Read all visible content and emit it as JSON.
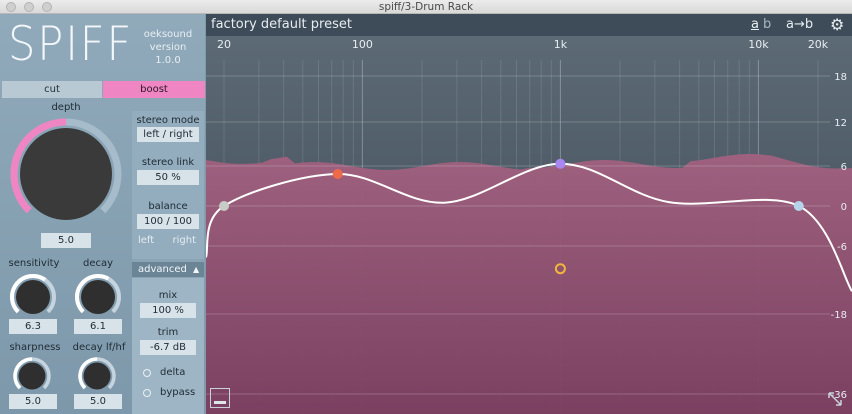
{
  "window": {
    "title": "spiff/3-Drum Rack"
  },
  "plugin": {
    "name": "SPIFF",
    "vendor": "oeksound",
    "version_label": "version",
    "version": "1.0.0"
  },
  "mode_tabs": {
    "cut": "cut",
    "boost": "boost",
    "active": "boost"
  },
  "depth": {
    "label": "depth",
    "value": "5.0",
    "fraction": 0.5
  },
  "sensitivity": {
    "label": "sensitivity",
    "value": "6.3",
    "fraction": 0.63
  },
  "decay": {
    "label": "decay",
    "value": "6.1",
    "fraction": 0.61
  },
  "sharpness": {
    "label": "sharpness",
    "value": "5.0",
    "fraction": 0.5
  },
  "decay_lf_hf": {
    "label": "decay lf/hf",
    "value": "5.0",
    "fraction": 0.5
  },
  "stereo_mode": {
    "label": "stereo mode",
    "value": "left / right"
  },
  "stereo_link": {
    "label": "stereo link",
    "value": "50 %"
  },
  "balance": {
    "label": "balance",
    "value": "100 / 100",
    "left": "left",
    "right": "right"
  },
  "advanced": {
    "label": "advanced",
    "arrow": "▲"
  },
  "mix": {
    "label": "mix",
    "value": "100 %"
  },
  "trim": {
    "label": "trim",
    "value": "-6.7 dB"
  },
  "options": {
    "delta": "delta",
    "bypass": "bypass"
  },
  "graph": {
    "preset_name": "factory default preset",
    "ab_a": "a",
    "ab_b": "b",
    "copy_ab": "a→b",
    "freq_labels": [
      {
        "label": "20",
        "hz": 20
      },
      {
        "label": "100",
        "hz": 100
      },
      {
        "label": "1k",
        "hz": 1000
      },
      {
        "label": "10k",
        "hz": 10000
      },
      {
        "label": "20k",
        "hz": 20000
      }
    ],
    "db_labels": [
      "18",
      "12",
      "6",
      "0",
      "-6",
      "-18",
      "-36"
    ],
    "nodes": [
      {
        "name": "low-shelf-node",
        "hz": 20,
        "db": 0,
        "color": "#c9cbc6",
        "filled": true
      },
      {
        "name": "band-1-node",
        "hz": 75,
        "db": 4.8,
        "color": "#ef6a48",
        "filled": true
      },
      {
        "name": "band-2-node",
        "hz": 1000,
        "db": 6.3,
        "color": "#a987f2",
        "filled": true
      },
      {
        "name": "band-3-node",
        "hz": 1000,
        "db": -10,
        "color": "#f0b63c",
        "filled": false
      },
      {
        "name": "high-shelf-node",
        "hz": 16000,
        "db": 0,
        "color": "#b6d3ec",
        "filled": true
      }
    ],
    "colors": {
      "accent": "#ef85c3",
      "spectrum": "#9b5a7c",
      "header": "#3d4c58",
      "curve": "#ffffff"
    }
  }
}
